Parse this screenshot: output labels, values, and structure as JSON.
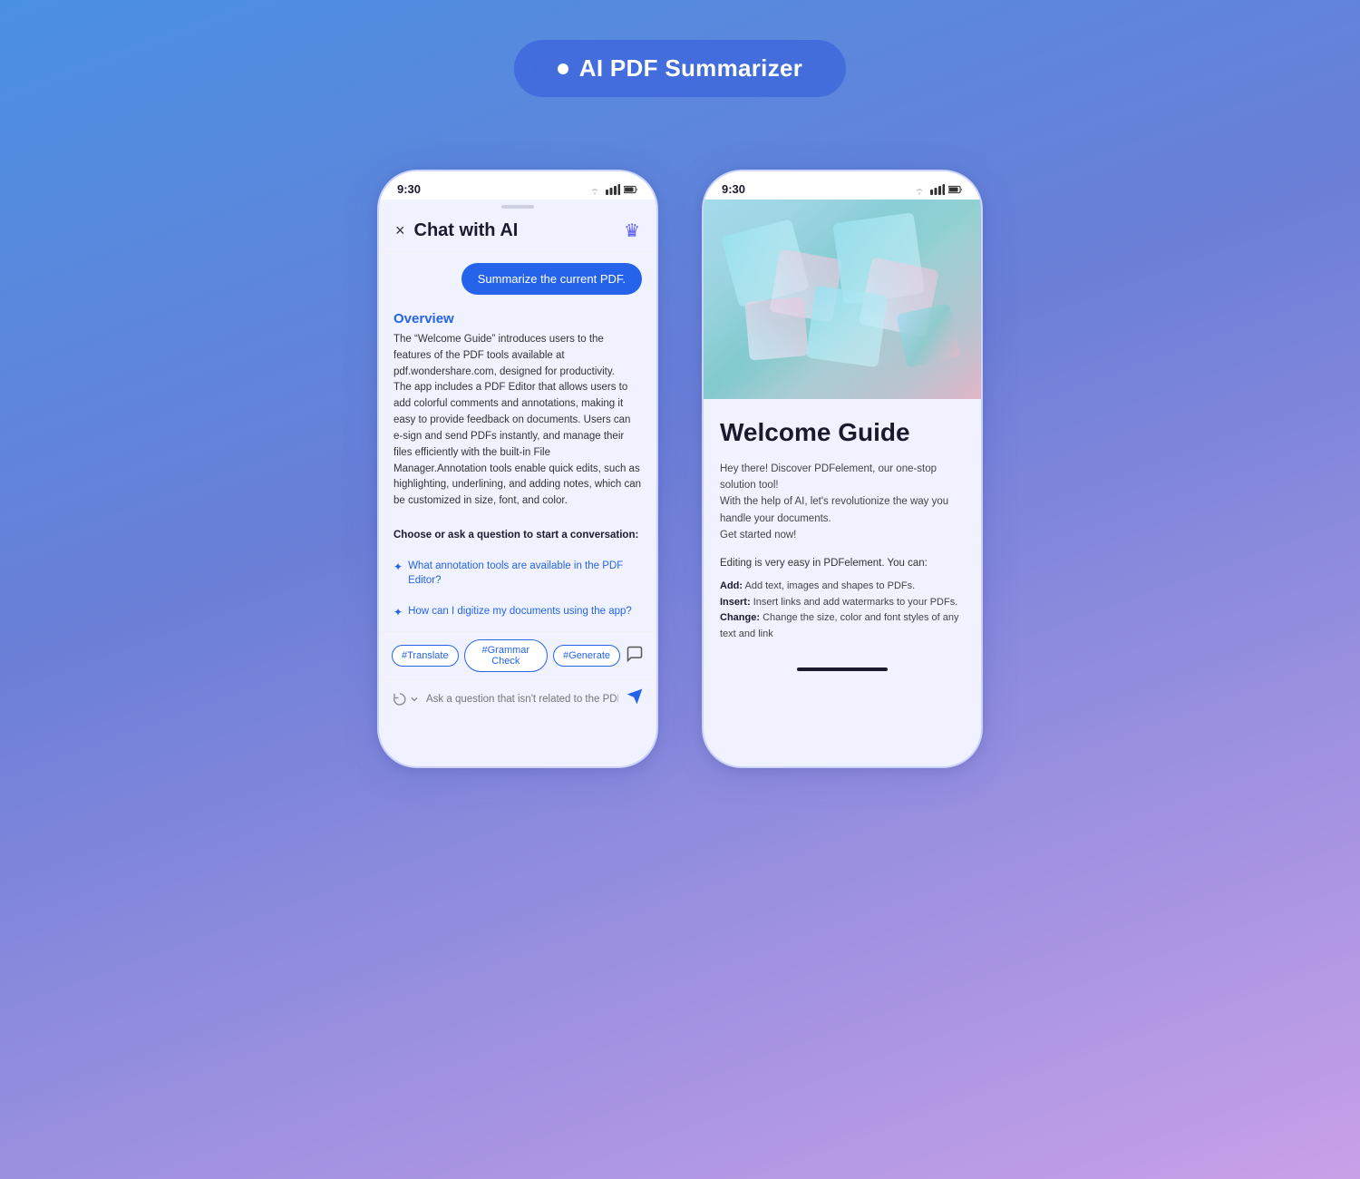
{
  "header": {
    "title": "AI PDF Summarizer",
    "dot": "●"
  },
  "left_phone": {
    "status": {
      "time": "9:30"
    },
    "chat_header": {
      "close_label": "×",
      "title": "Chat with AI",
      "crown": "♛"
    },
    "summarize_btn": "Summarize the current PDF.",
    "overview": {
      "title": "Overview",
      "body": "The \"Welcome Guide\" introduces users to the features of the PDF tools available at pdf.wondershare.com, designed for productivity.\nThe app includes a PDF Editor that allows users to add colorful comments and annotations, making it easy to provide feedback on documents. Users can e-sign and send PDFs instantly, and manage their files efficiently with the built-in File Manager.Annotation tools enable quick edits, such as highlighting, underlining, and adding notes, which can be customized in size, font, and color."
    },
    "conversation_prompt": "Choose or ask a question to start a conversation:",
    "suggestions": [
      "What annotation tools are available in the PDF Editor?",
      "How can I digitize my documents using the app?"
    ],
    "tags": [
      "#Translate",
      "#Grammar Check",
      "#Generate"
    ],
    "input_placeholder": "Ask a question that isn't related to the PDF."
  },
  "right_phone": {
    "status": {
      "time": "9:30"
    },
    "pdf_title": "Welcome Guide",
    "pdf_intro": "Hey there! Discover PDFelement, our one-stop solution tool!\nWith the help of AI, let's revolutionize the way you handle your documents.\nGet started now!",
    "pdf_section": "Editing is very easy in PDFelement. You can:",
    "pdf_list": [
      {
        "label": "Add:",
        "text": "Add text, images and shapes to PDFs."
      },
      {
        "label": "Insert:",
        "text": "Insert links and add watermarks to your PDFs."
      },
      {
        "label": "Change:",
        "text": "Change the size, color and font styles of any text and link"
      }
    ]
  }
}
